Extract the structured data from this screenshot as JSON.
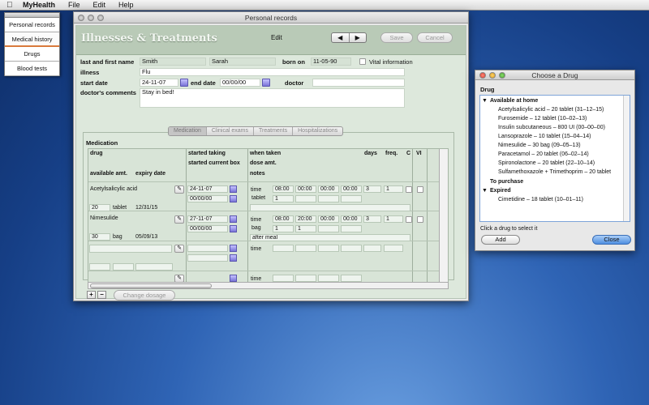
{
  "menubar": {
    "apple": "",
    "app": "MyHealth",
    "items": [
      "File",
      "Edit",
      "Help"
    ]
  },
  "palette": {
    "items": [
      "Personal records",
      "Medical history",
      "Drugs",
      "Blood tests"
    ]
  },
  "window": {
    "title": "Personal records",
    "header_title": "Illnesses & Treatments",
    "edit": "Edit",
    "nav_prev": "◀",
    "nav_next": "▶",
    "save": "Save",
    "cancel": "Cancel"
  },
  "form": {
    "labels": {
      "name": "last and first name",
      "born_on": "born on",
      "vital": "Vital information",
      "illness": "illness",
      "start_date": "start date",
      "end_date": "end date",
      "doctor": "doctor",
      "comments": "doctor's comments"
    },
    "last_name": "Smith",
    "first_name": "Sarah",
    "born_on": "11-05-90",
    "illness": "Flu",
    "start_date": "24-11-07",
    "end_date": "00/00/00",
    "doctor": "",
    "comments": "Stay in bed!"
  },
  "tabs": [
    "Medication",
    "Clinical exams",
    "Treatments",
    "Hospitalizations"
  ],
  "medication": {
    "title": "Medication",
    "headers": {
      "drug": "drug",
      "available": "available amt.",
      "expiry": "expiry date",
      "started_taking": "started taking",
      "started_box": "started current box",
      "when_taken": "when taken",
      "dose": "dose amt.",
      "notes": "notes",
      "days": "days",
      "freq": "freq.",
      "c": "C",
      "vi": "VI"
    },
    "rows": [
      {
        "drug": "Acetylsalicylic acid",
        "available": "20",
        "unit": "tablet",
        "expiry": "12/31/15",
        "started": "24-11-07",
        "box": "00/00/00",
        "label_time": "time",
        "times": [
          "08:00",
          "00:00",
          "00:00",
          "00:00"
        ],
        "days": "3",
        "freq": "1",
        "dose_unit": "tablet",
        "dose": "1",
        "notes": ""
      },
      {
        "drug": "Nimesulide",
        "available": "30",
        "unit": "bag",
        "expiry": "05/09/13",
        "started": "27-11-07",
        "box": "00/00/00",
        "label_time": "time",
        "times": [
          "08:00",
          "20:00",
          "00:00",
          "00:00"
        ],
        "days": "3",
        "freq": "1",
        "dose_unit": "bag",
        "dose": "1",
        "dose2": "1",
        "notes": "after meal"
      }
    ],
    "empty_time": "time",
    "pencil": "✎",
    "add": "+",
    "remove": "−",
    "change_dosage": "Change dosage"
  },
  "dialog": {
    "title": "Choose a Drug",
    "col": "Drug",
    "groups": [
      {
        "name": "Available at home",
        "arrow": "▼",
        "items": [
          "Acetylsalicylic acid – 20 tablet (31–12–15)",
          "Furosemide – 12 tablet (10–02–13)",
          "Insulin subcutaneous – 800 UI (00–00–00)",
          "Lansoprazole – 10 tablet (15–04–14)",
          "Nimesulide – 30 bag (09–05–13)",
          "Paracetamol – 20 tablet (06–02–14)",
          "Spironolactone – 20 tablet (22–10–14)",
          "Sulfamethoxazole + Trimethoprim – 20 tablet"
        ]
      },
      {
        "name": "To purchase",
        "arrow": "",
        "items": []
      },
      {
        "name": "Expired",
        "arrow": "▼",
        "items": [
          "Cimetidine – 18 tablet (10–01–11)"
        ]
      }
    ],
    "hint": "Click a drug to select it",
    "add": "Add",
    "close": "Close"
  }
}
